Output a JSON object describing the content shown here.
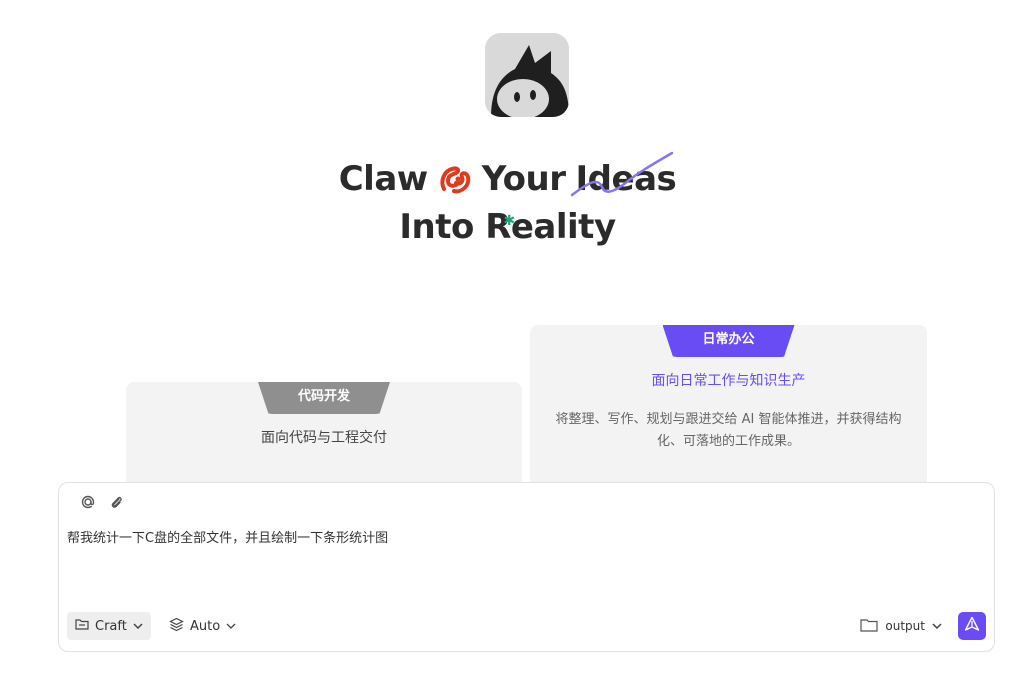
{
  "hero": {
    "line1_part1": "Claw",
    "line1_part2": "Your",
    "line1_part3": "Ideas",
    "line2": "Into Reality"
  },
  "cards": {
    "code": {
      "tab": "代码开发",
      "subtitle": "面向代码与工程交付"
    },
    "office": {
      "tab": "日常办公",
      "subtitle": "面向日常工作与知识生产",
      "description": "将整理、写作、规划与跟进交给 AI 智能体推进，并获得结构化、可落地的工作成果。"
    }
  },
  "composer": {
    "prompt_text": "帮我统计一下C盘的全部文件，并且绘制一下条形统计图",
    "mode_label": "Craft",
    "model_label": "Auto",
    "output_label": "output"
  },
  "colors": {
    "accent": "#6a4cf5",
    "tab_grey": "#8f8f8f",
    "card_bg": "#f3f3f4",
    "lobster": "#e03a1e"
  },
  "icons": [
    "app-logo-icon",
    "lobster-icon",
    "at-icon",
    "paperclip-icon",
    "folder-box-icon",
    "layers-icon",
    "folder-icon",
    "send-icon",
    "chevron-down-icon"
  ]
}
